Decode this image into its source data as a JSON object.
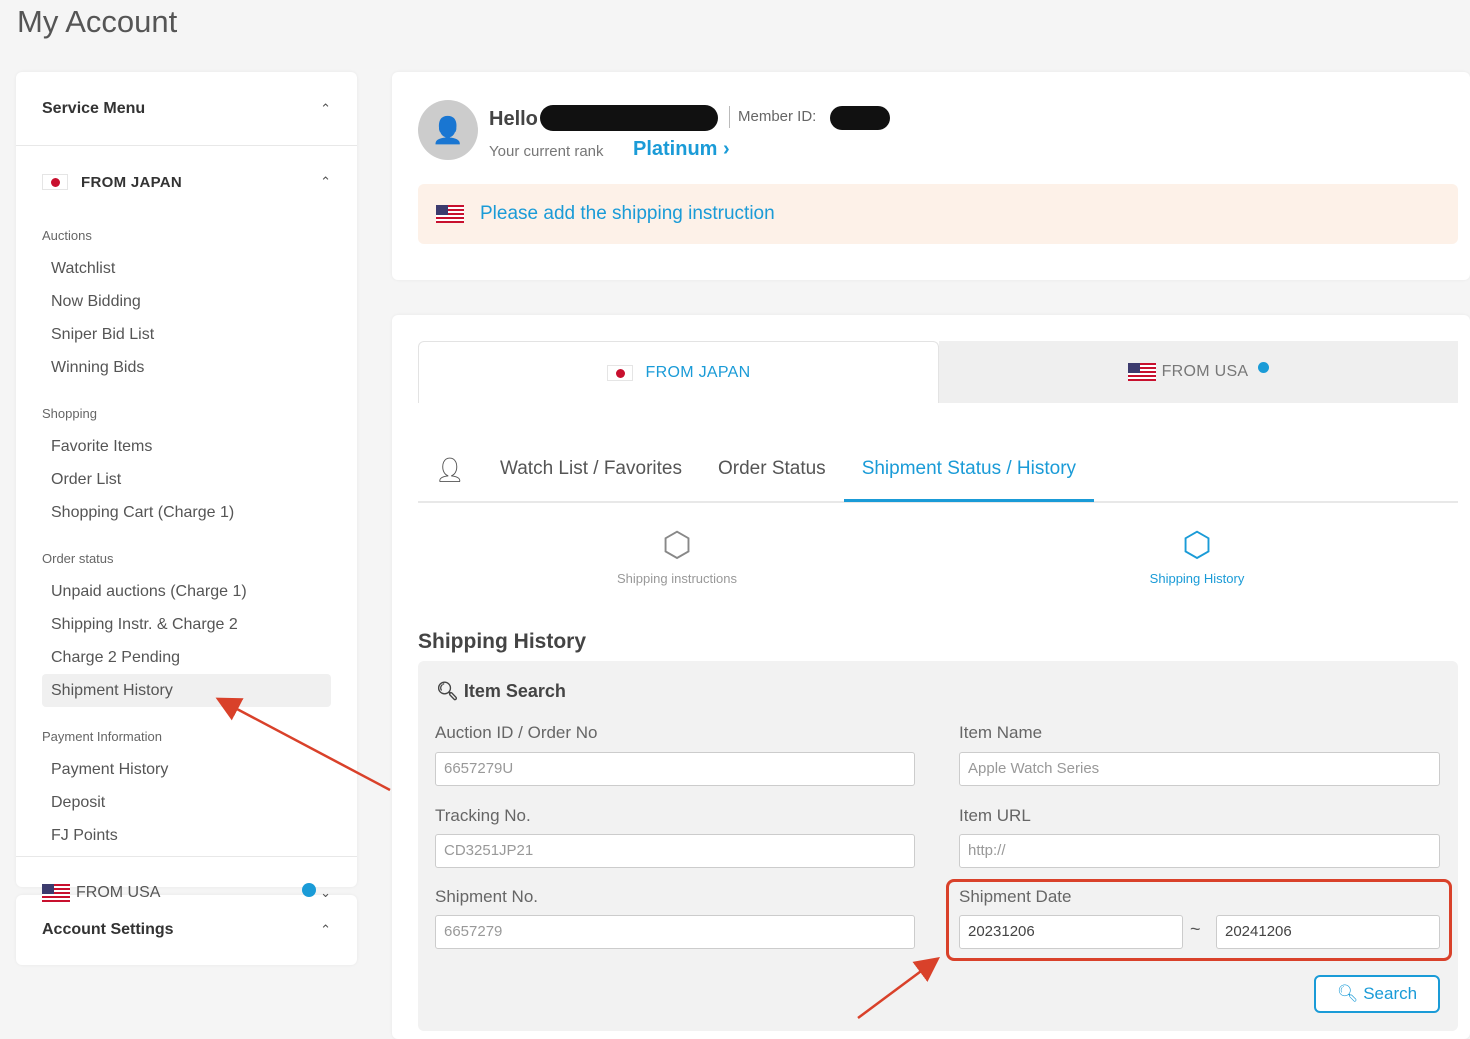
{
  "page": {
    "title": "My Account"
  },
  "sidebar": {
    "service_menu": "Service Menu",
    "from_japan": "FROM JAPAN",
    "groups": [
      {
        "label": "Auctions",
        "items": [
          "Watchlist",
          "Now Bidding",
          "Sniper Bid List",
          "Winning Bids"
        ]
      },
      {
        "label": "Shopping",
        "items": [
          "Favorite Items",
          "Order List",
          "Shopping Cart (Charge 1)"
        ]
      },
      {
        "label": "Order status",
        "items": [
          "Unpaid auctions (Charge 1)",
          "Shipping Instr. & Charge 2",
          "Charge 2 Pending",
          "Shipment History"
        ]
      },
      {
        "label": "Payment Information",
        "items": [
          "Payment History",
          "Deposit",
          "FJ Points"
        ]
      }
    ],
    "from_usa": "FROM USA",
    "account_settings": "Account Settings",
    "active_item": "Shipment History"
  },
  "profile": {
    "hello": "Hello",
    "member_id_label": "Member ID:",
    "rank_label": "Your current rank",
    "rank": "Platinum",
    "notice": "Please add the shipping instruction"
  },
  "country_tabs": [
    {
      "label": "FROM JAPAN",
      "active": true
    },
    {
      "label": "FROM USA",
      "active": false
    }
  ],
  "sub_tabs": [
    "Watch List / Favorites",
    "Order Status",
    "Shipment Status / History"
  ],
  "phases": [
    "Shipping instructions",
    "Shipping History"
  ],
  "section_title": "Shipping History",
  "search": {
    "title": "Item Search",
    "auction_id_label": "Auction ID / Order No",
    "auction_id_placeholder": "6657279U",
    "item_name_label": "Item Name",
    "item_name_placeholder": "Apple Watch Series",
    "tracking_label": "Tracking No.",
    "tracking_placeholder": "CD3251JP21",
    "item_url_label": "Item URL",
    "item_url_placeholder": "http://",
    "shipment_no_label": "Shipment No.",
    "shipment_no_placeholder": "6657279",
    "shipment_date_label": "Shipment Date",
    "date_from": "20231206",
    "date_to": "20241206",
    "range_sep": "~",
    "button": "Search"
  },
  "colors": {
    "accent": "#1a9bd7",
    "annotation": "#d9412a",
    "notice_bg": "#fdf1e8"
  }
}
